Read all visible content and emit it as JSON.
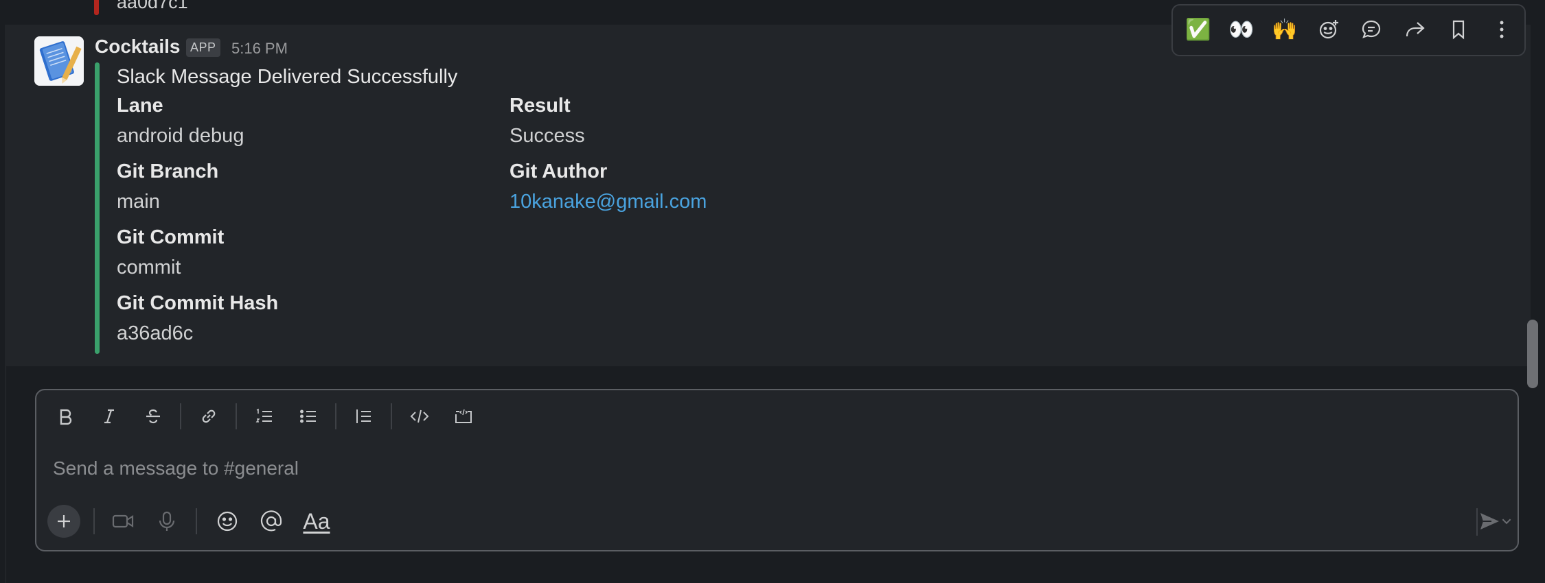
{
  "previous_message": {
    "text": "aa0d7c1"
  },
  "message": {
    "sender": "Cocktails",
    "badge": "APP",
    "time": "5:16 PM",
    "attachment_title": "Slack Message Delivered Successfully",
    "fields": {
      "lane": {
        "label": "Lane",
        "value": "android debug"
      },
      "result": {
        "label": "Result",
        "value": "Success"
      },
      "git_branch": {
        "label": "Git Branch",
        "value": "main"
      },
      "git_author": {
        "label": "Git Author",
        "value": "10kanake@gmail.com"
      },
      "git_commit": {
        "label": "Git Commit",
        "value": "commit"
      },
      "git_commit_hash": {
        "label": "Git Commit Hash",
        "value": "a36ad6c"
      }
    },
    "accent_color": "#3aa06b"
  },
  "hover_actions": {
    "check_emoji": "✅",
    "eyes_emoji": "👀",
    "hands_emoji": "🙌",
    "icons": [
      "add-reaction-icon",
      "reply-thread-icon",
      "forward-icon",
      "bookmark-icon",
      "more-actions-icon"
    ]
  },
  "composer": {
    "placeholder": "Send a message to #general",
    "format_icons": [
      "bold-icon",
      "italic-icon",
      "strikethrough-icon",
      "link-icon",
      "ordered-list-icon",
      "bulleted-list-icon",
      "blockquote-icon",
      "code-icon",
      "code-block-icon"
    ],
    "bottom_icons": [
      "plus-icon",
      "video-icon",
      "microphone-icon",
      "emoji-icon",
      "mention-icon",
      "formatting-icon",
      "send-icon",
      "chevron-down-icon"
    ],
    "format_label": "Aa"
  }
}
